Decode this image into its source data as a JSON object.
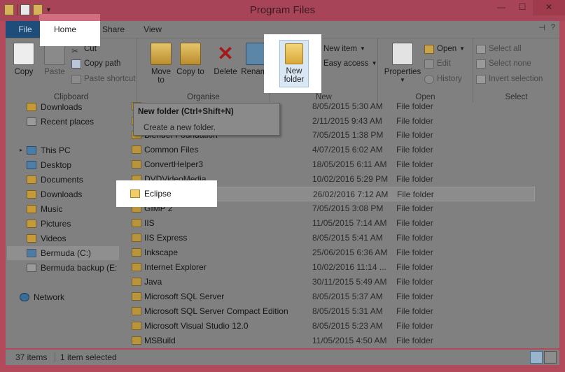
{
  "window": {
    "title": "Program Files"
  },
  "tabs": {
    "file": "File",
    "home": "Home",
    "share": "Share",
    "view": "View"
  },
  "ribbon": {
    "clipboard": {
      "label": "Clipboard",
      "copy": "Copy",
      "paste": "Paste",
      "cut": "Cut",
      "copy_path": "Copy path",
      "paste_shortcut": "Paste shortcut"
    },
    "organise": {
      "label": "Organise",
      "move_to": "Move to",
      "copy_to": "Copy to",
      "delete": "Delete",
      "rename": "Rename"
    },
    "new": {
      "label": "New",
      "new_folder_line1": "New",
      "new_folder_line2": "folder",
      "new_item": "New item",
      "easy_access": "Easy access"
    },
    "open": {
      "label": "Open",
      "properties": "Properties",
      "open": "Open",
      "edit": "Edit",
      "history": "History"
    },
    "select": {
      "label": "Select",
      "select_all": "Select all",
      "select_none": "Select none",
      "invert_selection": "Invert selection"
    }
  },
  "tooltip": {
    "title": "New folder (Ctrl+Shift+N)",
    "description": "Create a new folder."
  },
  "nav": {
    "items": [
      {
        "label": "Downloads"
      },
      {
        "label": "Recent places"
      },
      {
        "label": "This PC"
      },
      {
        "label": "Desktop"
      },
      {
        "label": "Documents"
      },
      {
        "label": "Downloads"
      },
      {
        "label": "Music"
      },
      {
        "label": "Pictures"
      },
      {
        "label": "Videos"
      },
      {
        "label": "Bermuda (C:)"
      },
      {
        "label": "Bermuda backup (E:"
      },
      {
        "label": "Network"
      }
    ]
  },
  "files": [
    {
      "name": "",
      "date": "8/05/2015 5:30 AM",
      "type": "File folder"
    },
    {
      "name": "",
      "date": "2/11/2015 9:43 AM",
      "type": "File folder"
    },
    {
      "name": "Blender Foundation",
      "date": "7/05/2015 1:38 PM",
      "type": "File folder"
    },
    {
      "name": "Common Files",
      "date": "4/07/2015 6:02 AM",
      "type": "File folder"
    },
    {
      "name": "ConvertHelper3",
      "date": "18/05/2015 6:11 AM",
      "type": "File folder"
    },
    {
      "name": "DVDVideoMedia",
      "date": "10/02/2016 5:29 PM",
      "type": "File folder"
    },
    {
      "name": "Eclipse",
      "date": "26/02/2016 7:12 AM",
      "type": "File folder"
    },
    {
      "name": "GIMP 2",
      "date": "7/05/2015 3:08 PM",
      "type": "File folder"
    },
    {
      "name": "IIS",
      "date": "11/05/2015 7:14 AM",
      "type": "File folder"
    },
    {
      "name": "IIS Express",
      "date": "8/05/2015 5:41 AM",
      "type": "File folder"
    },
    {
      "name": "Inkscape",
      "date": "25/06/2015 6:36 AM",
      "type": "File folder"
    },
    {
      "name": "Internet Explorer",
      "date": "10/02/2016 11:14 ...",
      "type": "File folder"
    },
    {
      "name": "Java",
      "date": "30/11/2015 5:49 AM",
      "type": "File folder"
    },
    {
      "name": "Microsoft SQL Server",
      "date": "8/05/2015 5:37 AM",
      "type": "File folder"
    },
    {
      "name": "Microsoft SQL Server Compact Edition",
      "date": "8/05/2015 5:31 AM",
      "type": "File folder"
    },
    {
      "name": "Microsoft Visual Studio 12.0",
      "date": "8/05/2015 5:23 AM",
      "type": "File folder"
    },
    {
      "name": "MSBuild",
      "date": "11/05/2015 4:50 AM",
      "type": "File folder"
    }
  ],
  "status": {
    "item_count": "37 items",
    "selected": "1 item selected"
  }
}
